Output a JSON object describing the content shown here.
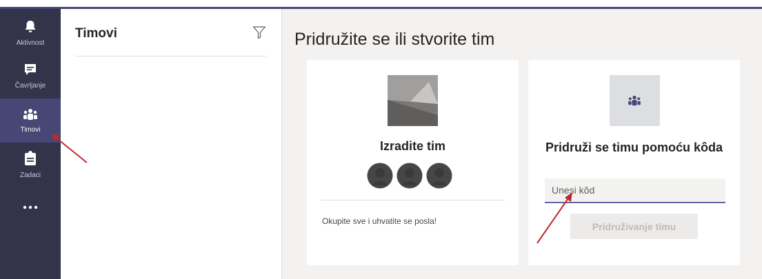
{
  "rail": {
    "items": [
      {
        "label": "Aktivnost",
        "icon": "bell-icon"
      },
      {
        "label": "Čavrljanje",
        "icon": "chat-icon"
      },
      {
        "label": "Timovi",
        "icon": "teams-icon",
        "active": true
      },
      {
        "label": "Zadaci",
        "icon": "assignments-icon"
      },
      {
        "label": "",
        "icon": "more-icon"
      }
    ]
  },
  "panel": {
    "title": "Timovi",
    "filter_icon": "filter-icon"
  },
  "main": {
    "title": "Pridružite se ili stvorite tim",
    "create_card": {
      "heading": "Izradite tim",
      "description": "Okupite sve i uhvatite se posla!"
    },
    "join_card": {
      "heading": "Pridruži se timu pomoću kôda",
      "input_placeholder": "Unesi kôd",
      "button_label": "Pridruživanje timu"
    }
  },
  "colors": {
    "rail_bg": "#33344a",
    "accent": "#6264a7",
    "active_bg": "#464775",
    "annotation_arrow": "#c0282d"
  }
}
